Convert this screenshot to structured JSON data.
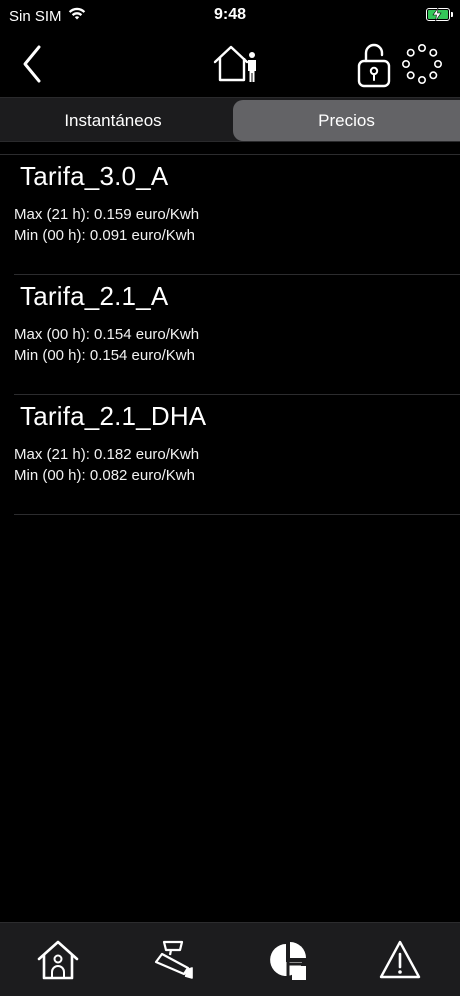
{
  "status_bar": {
    "carrier": "Sin SIM",
    "time": "9:48",
    "battery_color": "#34c759",
    "icons": [
      "wifi-icon",
      "battery-charging-icon"
    ]
  },
  "nav": {
    "icons": [
      "back-chevron-icon",
      "home-user-icon",
      "unlocked-padlock-icon",
      "loading-spinner-icon"
    ]
  },
  "tabs": {
    "items": [
      {
        "label": "Instantáneos",
        "selected": false
      },
      {
        "label": "Precios",
        "selected": true
      }
    ]
  },
  "tariffs": [
    {
      "name": "Tarifa_3.0_A",
      "max": "Max (21 h): 0.159 euro/Kwh",
      "min": "Min (00 h): 0.091 euro/Kwh"
    },
    {
      "name": "Tarifa_2.1_A",
      "max": "Max (00 h): 0.154 euro/Kwh",
      "min": "Min (00 h): 0.154 euro/Kwh"
    },
    {
      "name": "Tarifa_2.1_DHA",
      "max": "Max (21 h): 0.182 euro/Kwh",
      "min": "Min (00 h): 0.082 euro/Kwh"
    }
  ],
  "tab_bar": {
    "icons": [
      "house-icon",
      "security-camera-icon",
      "pie-chart-icon",
      "warning-icon"
    ],
    "selected_index": 2
  }
}
